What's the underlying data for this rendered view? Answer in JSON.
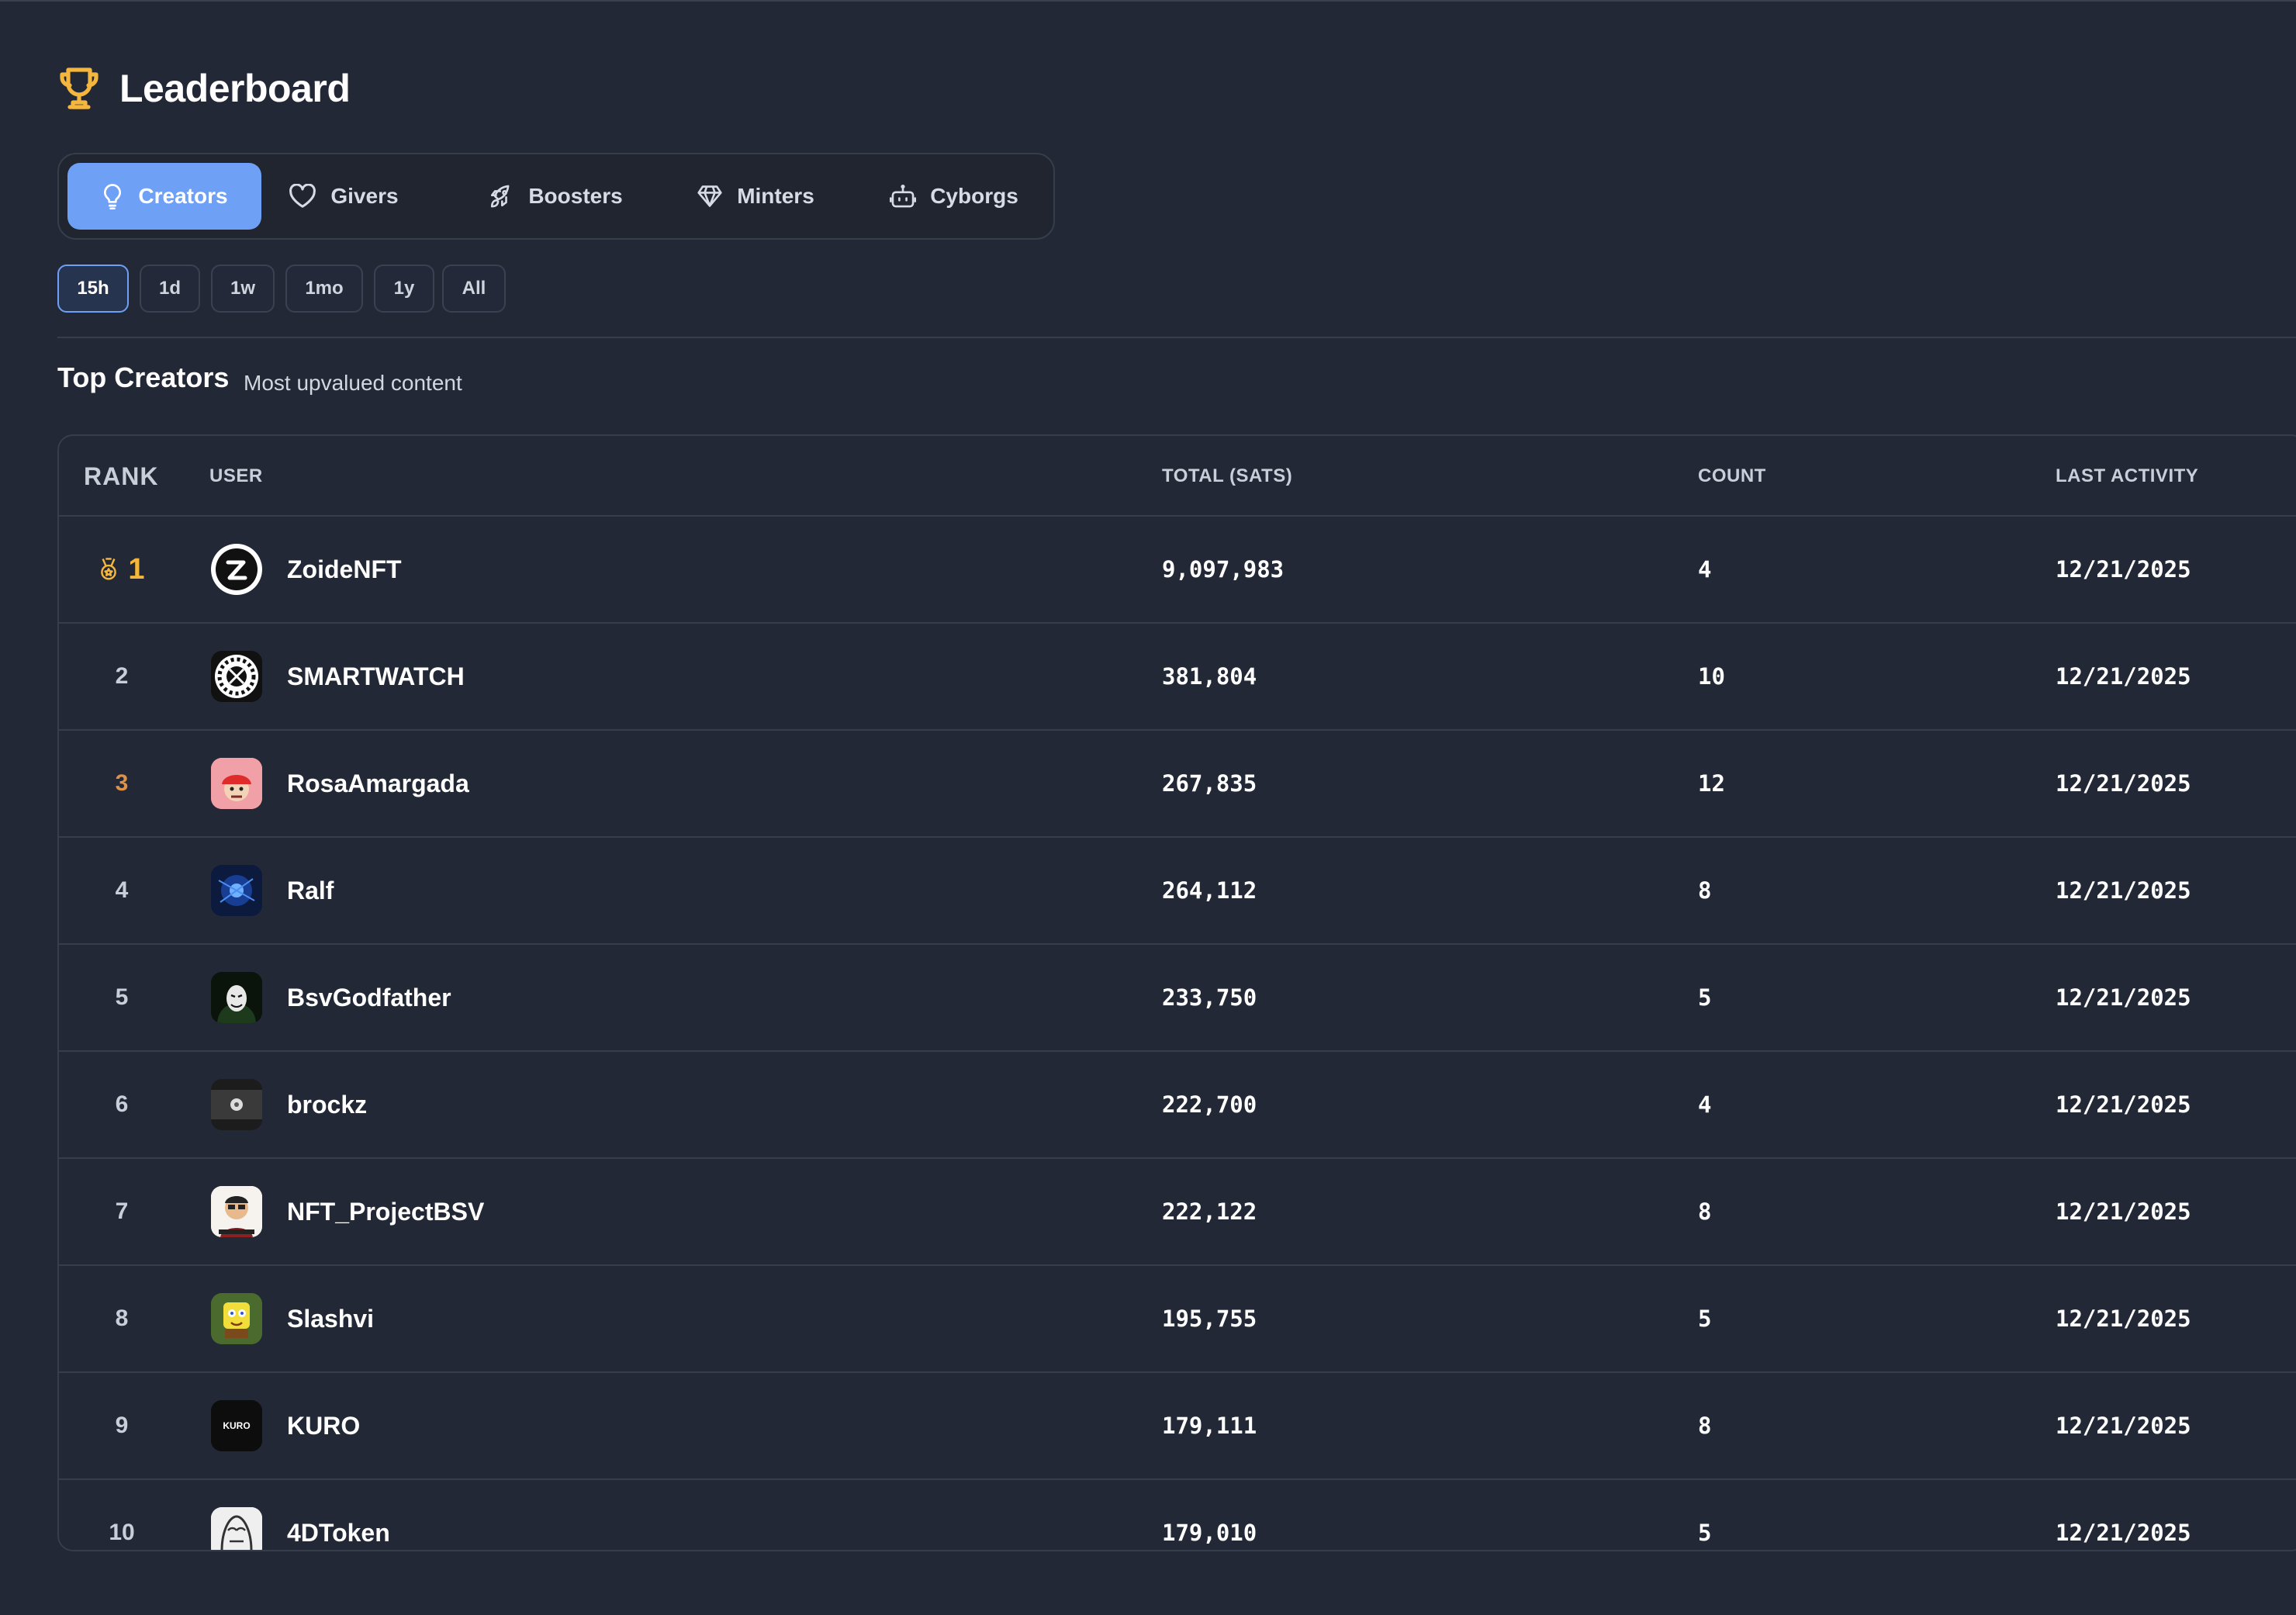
{
  "header": {
    "title": "Leaderboard",
    "icon": "trophy-icon",
    "icon_color": "#f4b63c"
  },
  "tabs": [
    {
      "label": "Creators",
      "icon": "lightbulb-icon",
      "active": true
    },
    {
      "label": "Givers",
      "icon": "heart-icon",
      "active": false
    },
    {
      "label": "Boosters",
      "icon": "rocket-icon",
      "active": false
    },
    {
      "label": "Minters",
      "icon": "diamond-icon",
      "active": false
    },
    {
      "label": "Cyborgs",
      "icon": "robot-icon",
      "active": false
    }
  ],
  "periods": [
    {
      "label": "15h",
      "active": true
    },
    {
      "label": "1d",
      "active": false
    },
    {
      "label": "1w",
      "active": false
    },
    {
      "label": "1mo",
      "active": false
    },
    {
      "label": "1y",
      "active": false
    },
    {
      "label": "All",
      "active": false
    }
  ],
  "section": {
    "title": "Top Creators",
    "subtitle": "Most upvalued content"
  },
  "table": {
    "columns": {
      "rank": "RANK",
      "user": "USER",
      "total": "TOTAL (SATS)",
      "count": "COUNT",
      "last_activity": "LAST ACTIVITY"
    },
    "rows": [
      {
        "rank": "1",
        "user": "ZoideNFT",
        "total": "9,097,983",
        "count": "4",
        "last_activity": "12/21/2025"
      },
      {
        "rank": "2",
        "user": "SMARTWATCH",
        "total": "381,804",
        "count": "10",
        "last_activity": "12/21/2025"
      },
      {
        "rank": "3",
        "user": "RosaAmargada",
        "total": "267,835",
        "count": "12",
        "last_activity": "12/21/2025"
      },
      {
        "rank": "4",
        "user": "Ralf",
        "total": "264,112",
        "count": "8",
        "last_activity": "12/21/2025"
      },
      {
        "rank": "5",
        "user": "BsvGodfather",
        "total": "233,750",
        "count": "5",
        "last_activity": "12/21/2025"
      },
      {
        "rank": "6",
        "user": "brockz",
        "total": "222,700",
        "count": "4",
        "last_activity": "12/21/2025"
      },
      {
        "rank": "7",
        "user": "NFT_ProjectBSV",
        "total": "222,122",
        "count": "8",
        "last_activity": "12/21/2025"
      },
      {
        "rank": "8",
        "user": "Slashvi",
        "total": "195,755",
        "count": "5",
        "last_activity": "12/21/2025"
      },
      {
        "rank": "9",
        "user": "KURO",
        "total": "179,111",
        "count": "8",
        "last_activity": "12/21/2025"
      },
      {
        "rank": "10",
        "user": "4DToken",
        "total": "179,010",
        "count": "5",
        "last_activity": "12/21/2025"
      }
    ]
  },
  "avatars": {
    "kuro_text": "KURO"
  },
  "colors": {
    "background": "#222836",
    "accent": "#6ea0f5",
    "gold": "#f4b63c",
    "bronze": "#de9248",
    "border": "#363d4b"
  }
}
